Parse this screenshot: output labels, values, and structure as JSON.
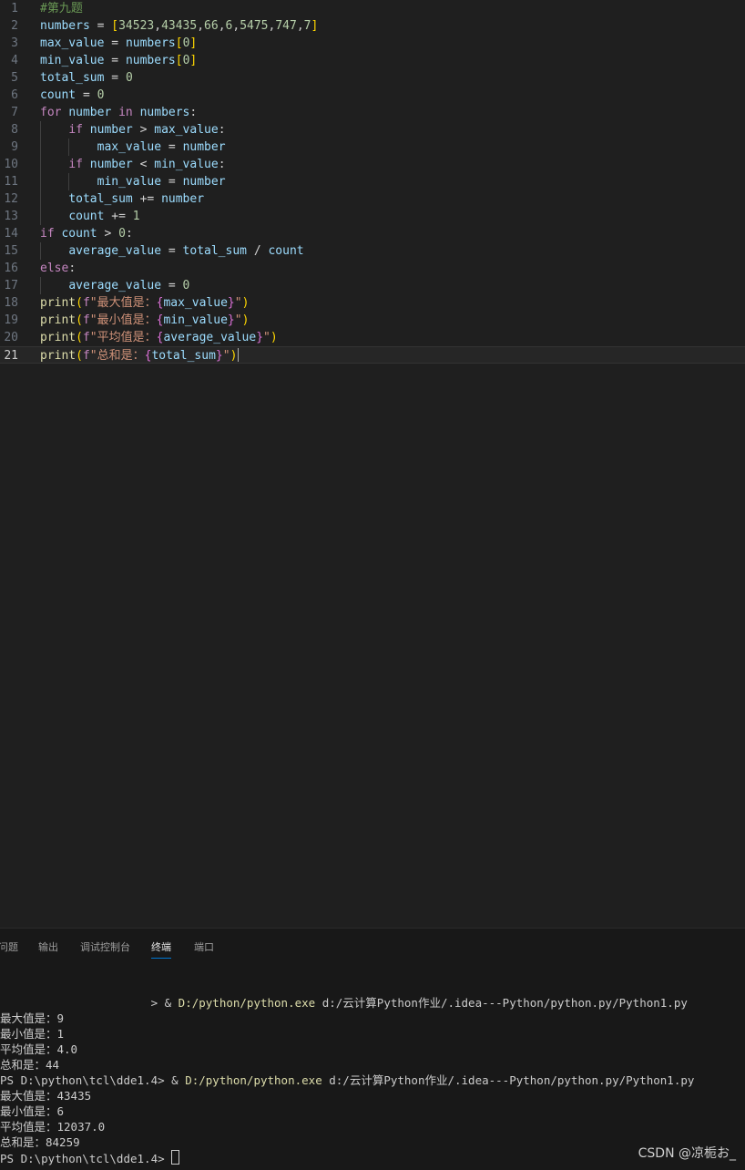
{
  "editor": {
    "lines": [
      {
        "n": "1",
        "tokens": [
          [
            "c-com",
            "#第九题"
          ]
        ]
      },
      {
        "n": "2",
        "tokens": [
          [
            "c-var",
            "numbers"
          ],
          [
            "c-op",
            " = "
          ],
          [
            "c-br1",
            "["
          ],
          [
            "c-num",
            "34523"
          ],
          [
            "c-pl",
            ","
          ],
          [
            "c-num",
            "43435"
          ],
          [
            "c-pl",
            ","
          ],
          [
            "c-num",
            "66"
          ],
          [
            "c-pl",
            ","
          ],
          [
            "c-num",
            "6"
          ],
          [
            "c-pl",
            ","
          ],
          [
            "c-num",
            "5475"
          ],
          [
            "c-pl",
            ","
          ],
          [
            "c-num",
            "747"
          ],
          [
            "c-pl",
            ","
          ],
          [
            "c-num",
            "7"
          ],
          [
            "c-br1",
            "]"
          ]
        ]
      },
      {
        "n": "3",
        "tokens": [
          [
            "c-var",
            "max_value"
          ],
          [
            "c-op",
            " = "
          ],
          [
            "c-var",
            "numbers"
          ],
          [
            "c-br1",
            "["
          ],
          [
            "c-num",
            "0"
          ],
          [
            "c-br1",
            "]"
          ]
        ]
      },
      {
        "n": "4",
        "tokens": [
          [
            "c-var",
            "min_value"
          ],
          [
            "c-op",
            " = "
          ],
          [
            "c-var",
            "numbers"
          ],
          [
            "c-br1",
            "["
          ],
          [
            "c-num",
            "0"
          ],
          [
            "c-br1",
            "]"
          ]
        ]
      },
      {
        "n": "5",
        "tokens": [
          [
            "c-var",
            "total_sum"
          ],
          [
            "c-op",
            " = "
          ],
          [
            "c-num",
            "0"
          ]
        ]
      },
      {
        "n": "6",
        "tokens": [
          [
            "c-var",
            "count"
          ],
          [
            "c-op",
            " = "
          ],
          [
            "c-num",
            "0"
          ]
        ]
      },
      {
        "n": "7",
        "tokens": [
          [
            "c-kw",
            "for"
          ],
          [
            "c-pl",
            " "
          ],
          [
            "c-var",
            "number"
          ],
          [
            "c-pl",
            " "
          ],
          [
            "c-kw",
            "in"
          ],
          [
            "c-pl",
            " "
          ],
          [
            "c-var",
            "numbers"
          ],
          [
            "c-pl",
            ":"
          ]
        ]
      },
      {
        "n": "8",
        "tokens": [
          [
            "c-pl",
            "    "
          ],
          [
            "c-kw",
            "if"
          ],
          [
            "c-pl",
            " "
          ],
          [
            "c-var",
            "number"
          ],
          [
            "c-op",
            " > "
          ],
          [
            "c-var",
            "max_value"
          ],
          [
            "c-pl",
            ":"
          ]
        ]
      },
      {
        "n": "9",
        "tokens": [
          [
            "c-pl",
            "        "
          ],
          [
            "c-var",
            "max_value"
          ],
          [
            "c-op",
            " = "
          ],
          [
            "c-var",
            "number"
          ]
        ]
      },
      {
        "n": "10",
        "tokens": [
          [
            "c-pl",
            "    "
          ],
          [
            "c-kw",
            "if"
          ],
          [
            "c-pl",
            " "
          ],
          [
            "c-var",
            "number"
          ],
          [
            "c-op",
            " < "
          ],
          [
            "c-var",
            "min_value"
          ],
          [
            "c-pl",
            ":"
          ]
        ]
      },
      {
        "n": "11",
        "tokens": [
          [
            "c-pl",
            "        "
          ],
          [
            "c-var",
            "min_value"
          ],
          [
            "c-op",
            " = "
          ],
          [
            "c-var",
            "number"
          ]
        ]
      },
      {
        "n": "12",
        "tokens": [
          [
            "c-pl",
            "    "
          ],
          [
            "c-var",
            "total_sum"
          ],
          [
            "c-op",
            " += "
          ],
          [
            "c-var",
            "number"
          ]
        ]
      },
      {
        "n": "13",
        "tokens": [
          [
            "c-pl",
            "    "
          ],
          [
            "c-var",
            "count"
          ],
          [
            "c-op",
            " += "
          ],
          [
            "c-num",
            "1"
          ]
        ]
      },
      {
        "n": "14",
        "tokens": [
          [
            "c-kw",
            "if"
          ],
          [
            "c-pl",
            " "
          ],
          [
            "c-var",
            "count"
          ],
          [
            "c-op",
            " > "
          ],
          [
            "c-num",
            "0"
          ],
          [
            "c-pl",
            ":"
          ]
        ]
      },
      {
        "n": "15",
        "tokens": [
          [
            "c-pl",
            "    "
          ],
          [
            "c-var",
            "average_value"
          ],
          [
            "c-op",
            " = "
          ],
          [
            "c-var",
            "total_sum"
          ],
          [
            "c-op",
            " / "
          ],
          [
            "c-var",
            "count"
          ]
        ]
      },
      {
        "n": "16",
        "tokens": [
          [
            "c-kw",
            "else"
          ],
          [
            "c-pl",
            ":"
          ]
        ]
      },
      {
        "n": "17",
        "tokens": [
          [
            "c-pl",
            "    "
          ],
          [
            "c-var",
            "average_value"
          ],
          [
            "c-op",
            " = "
          ],
          [
            "c-num",
            "0"
          ]
        ]
      },
      {
        "n": "18",
        "tokens": [
          [
            "c-fn",
            "print"
          ],
          [
            "c-br1",
            "("
          ],
          [
            "c-kw",
            "f"
          ],
          [
            "c-str",
            "\"最大值是："
          ],
          [
            "c-br2",
            "{"
          ],
          [
            "c-var",
            "max_value"
          ],
          [
            "c-br2",
            "}"
          ],
          [
            "c-str",
            "\""
          ],
          [
            "c-br1",
            ")"
          ]
        ]
      },
      {
        "n": "19",
        "tokens": [
          [
            "c-fn",
            "print"
          ],
          [
            "c-br1",
            "("
          ],
          [
            "c-kw",
            "f"
          ],
          [
            "c-str",
            "\"最小值是："
          ],
          [
            "c-br2",
            "{"
          ],
          [
            "c-var",
            "min_value"
          ],
          [
            "c-br2",
            "}"
          ],
          [
            "c-str",
            "\""
          ],
          [
            "c-br1",
            ")"
          ]
        ]
      },
      {
        "n": "20",
        "tokens": [
          [
            "c-fn",
            "print"
          ],
          [
            "c-br1",
            "("
          ],
          [
            "c-kw",
            "f"
          ],
          [
            "c-str",
            "\"平均值是："
          ],
          [
            "c-br2",
            "{"
          ],
          [
            "c-var",
            "average_value"
          ],
          [
            "c-br2",
            "}"
          ],
          [
            "c-str",
            "\""
          ],
          [
            "c-br1",
            ")"
          ]
        ]
      },
      {
        "n": "21",
        "tokens": [
          [
            "c-fn",
            "print"
          ],
          [
            "c-br1",
            "("
          ],
          [
            "c-kw",
            "f"
          ],
          [
            "c-str",
            "\"总和是："
          ],
          [
            "c-br2",
            "{"
          ],
          [
            "c-var",
            "total_sum"
          ],
          [
            "c-br2",
            "}"
          ],
          [
            "c-str",
            "\""
          ],
          [
            "c-br1",
            ")"
          ]
        ]
      }
    ]
  },
  "panel": {
    "tabs": [
      "问题",
      "输出",
      "调试控制台",
      "终端",
      "端口"
    ],
    "active_tab": "终端"
  },
  "terminal": {
    "lines": [
      [
        [
          "",
          "                      > & "
        ],
        [
          "t-yellow",
          "D:/python/python.exe"
        ],
        [
          "",
          " d:/云计算Python作业/.idea---Python/python.py/Python1.py"
        ]
      ],
      [
        [
          "",
          "最大值是：9"
        ]
      ],
      [
        [
          "",
          "最小值是：1"
        ]
      ],
      [
        [
          "",
          "平均值是：4.0"
        ]
      ],
      [
        [
          "",
          "总和是：44"
        ]
      ],
      [
        [
          "",
          "PS D:\\python\\tcl\\dde1.4> & "
        ],
        [
          "t-yellow",
          "D:/python/python.exe"
        ],
        [
          "",
          " d:/云计算Python作业/.idea---Python/python.py/Python1.py"
        ]
      ],
      [
        [
          "",
          "最大值是：43435"
        ]
      ],
      [
        [
          "",
          "最小值是：6"
        ]
      ],
      [
        [
          "",
          "平均值是：12037.0"
        ]
      ],
      [
        [
          "",
          "总和是：84259"
        ]
      ],
      [
        [
          "",
          "PS D:\\python\\tcl\\dde1.4> "
        ]
      ]
    ]
  },
  "watermark": "CSDN @凉栀お_",
  "colors": {
    "accent": "#0078d4",
    "background": "#1f1f1f",
    "panel": "#181818"
  }
}
